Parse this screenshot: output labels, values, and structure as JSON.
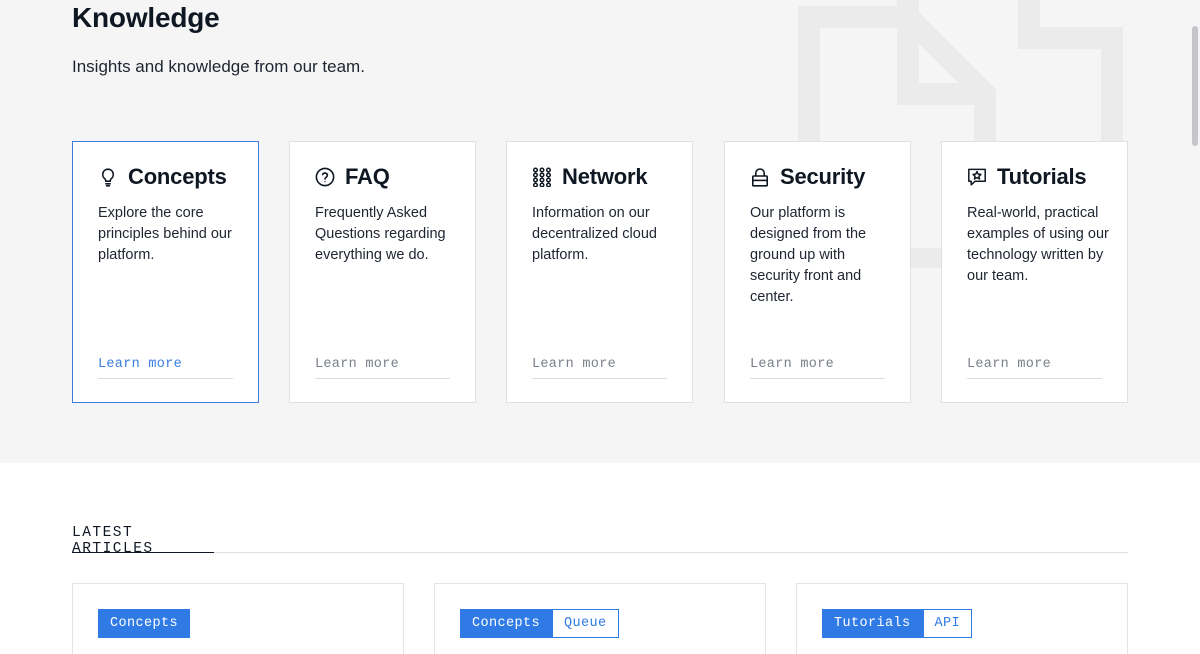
{
  "hero": {
    "title": "Knowledge",
    "subtitle": "Insights and knowledge from our team."
  },
  "categories": [
    {
      "title": "Concepts",
      "icon": "lightbulb-icon",
      "description": "Explore the core principles behind our platform.",
      "link": "Learn more",
      "active": true
    },
    {
      "title": "FAQ",
      "icon": "question-circle-icon",
      "description": "Frequently Asked Questions regarding everything we do.",
      "link": "Learn more",
      "active": false
    },
    {
      "title": "Network",
      "icon": "grid-dots-icon",
      "description": "Information on our decentralized cloud platform.",
      "link": "Learn more",
      "active": false
    },
    {
      "title": "Security",
      "icon": "lock-icon",
      "description": "Our platform is designed from the ground up with security front and center.",
      "link": "Learn more",
      "active": false
    },
    {
      "title": "Tutorials",
      "icon": "chat-star-icon",
      "description": "Real-world, practical examples of using our technology written by our team.",
      "link": "Learn more",
      "active": false
    }
  ],
  "latest": {
    "label": "LATEST ARTICLES",
    "articles": [
      {
        "tags": [
          "Concepts"
        ]
      },
      {
        "tags": [
          "Concepts",
          "Queue"
        ]
      },
      {
        "tags": [
          "Tutorials",
          "API"
        ]
      }
    ]
  },
  "colors": {
    "accent": "#2f7ae5",
    "hero_bg": "#f5f5f6",
    "text": "#0f1722"
  }
}
